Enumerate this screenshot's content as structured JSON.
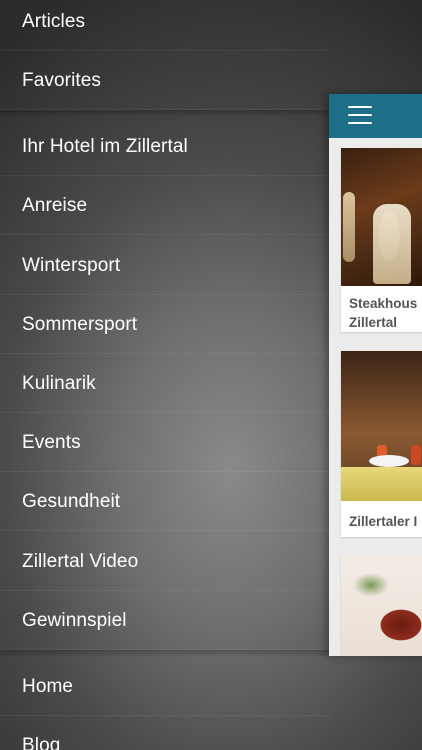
{
  "drawer": {
    "top_items": [
      "Articles",
      "Favorites"
    ],
    "category_items": [
      "Ihr Hotel im Zillertal",
      "Anreise",
      "Wintersport",
      "Sommersport",
      "Kulinarik",
      "Events",
      "Gesundheit",
      "Zillertal Video",
      "Gewinnspiel"
    ],
    "bottom_items": [
      "Home",
      "Blog"
    ]
  },
  "panel": {
    "navbar_color": "#1d6e89",
    "menu_icon": "hamburger-menu-icon",
    "cards": [
      {
        "title_line1": "Steakhous",
        "title_line2": "Zillertal"
      },
      {
        "title_line1": "Zillertaler I"
      },
      {
        "title_line1": ""
      }
    ]
  }
}
